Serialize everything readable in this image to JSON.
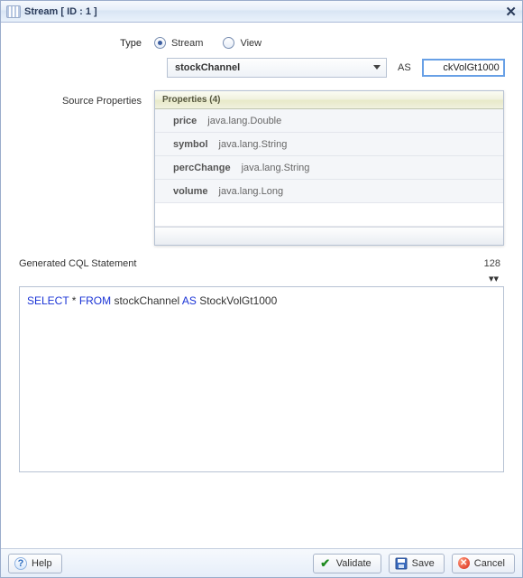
{
  "window": {
    "title": "Stream [ ID : 1 ]"
  },
  "form": {
    "type_label": "Type",
    "radio_stream": "Stream",
    "radio_view": "View",
    "selected_type": "Stream",
    "dropdown_value": "stockChannel",
    "as_label": "AS",
    "alias_value": "ckVolGt1000"
  },
  "source_props": {
    "label": "Source Properties",
    "header": "Properties (4)",
    "rows": [
      {
        "name": "price",
        "type": "java.lang.Double"
      },
      {
        "name": "symbol",
        "type": "java.lang.String"
      },
      {
        "name": "percChange",
        "type": "java.lang.String"
      },
      {
        "name": "volume",
        "type": "java.lang.Long"
      }
    ]
  },
  "generated": {
    "label": "Generated CQL Statement",
    "counter": "128",
    "upper_marks": "▾▾",
    "kw_select": "SELECT",
    "star": " * ",
    "kw_from": "FROM",
    "source": " stockChannel ",
    "kw_as": "AS",
    "alias": " StockVolGt1000"
  },
  "footer": {
    "help": "Help",
    "validate": "Validate",
    "save": "Save",
    "cancel": "Cancel"
  }
}
